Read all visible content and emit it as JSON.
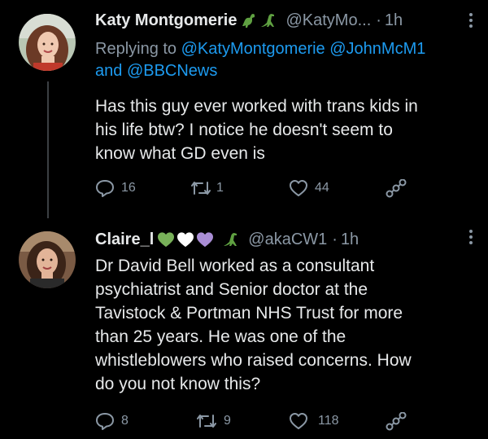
{
  "tweets": [
    {
      "name": "Katy Montgomerie",
      "handle": "@KatyMo...",
      "separator": "·",
      "time": "1h",
      "replying_prefix": "Replying to",
      "replying_handle1": "@KatyMontgomerie",
      "replying_handle2": "@JohnMcM1",
      "replying_and": "and",
      "replying_handle3": "@BBCNews",
      "body": [
        "Has this guy ever worked with trans kids in",
        "his life btw? I notice he doesn't seem to",
        "know what GD even is"
      ],
      "reply_count": "16",
      "retweet_count": "1",
      "like_count": "44",
      "name_emoji": [
        "dinosaur-icon",
        "dinosaur-icon"
      ]
    },
    {
      "name": "Claire_l",
      "handle": "@akaCW1",
      "separator": "·",
      "time": "1h",
      "body": [
        "Dr David Bell worked as a consultant",
        "psychiatrist and Senior doctor at the",
        "Tavistock & Portman NHS Trust for more",
        "than 25 years. He was one of the",
        "whistleblowers who raised concerns. How",
        "do you not know this?"
      ],
      "reply_count": "8",
      "retweet_count": "9",
      "like_count": "118",
      "name_emoji": [
        "green-heart-icon",
        "white-heart-icon",
        "purple-heart-icon",
        "dinosaur-icon"
      ]
    }
  ],
  "colors": {
    "background": "#000000",
    "text": "#e7e9ea",
    "secondary": "#8b98a5",
    "link": "#1d9bf0",
    "green_heart": "#78b159",
    "white_heart": "#ffffff",
    "purple_heart": "#aa8ed6",
    "dino": "#5fa041"
  }
}
